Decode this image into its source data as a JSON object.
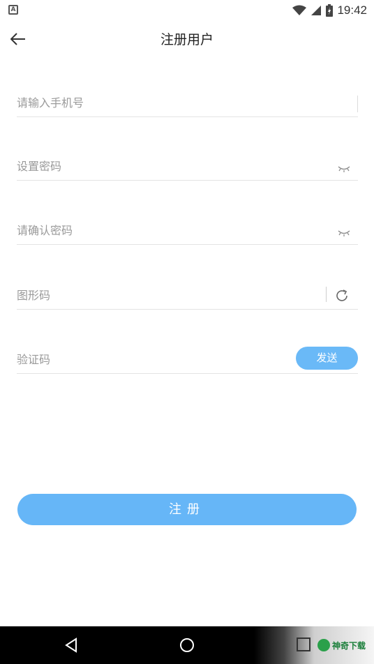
{
  "status_bar": {
    "app_icon_letter": "A",
    "time": "19:42"
  },
  "header": {
    "title": "注册用户"
  },
  "form": {
    "phone_placeholder": "请输入手机号",
    "password_placeholder": "设置密码",
    "confirm_password_placeholder": "请确认密码",
    "captcha_placeholder": "图形码",
    "sms_code_placeholder": "验证码",
    "send_label": "发送"
  },
  "register_label": "注册",
  "watermark": {
    "text": "神奇下载"
  },
  "colors": {
    "accent": "#66b6f7",
    "accent_light": "#6ab9f7",
    "divider": "#e3e3e3",
    "placeholder": "#9a9a9a"
  }
}
